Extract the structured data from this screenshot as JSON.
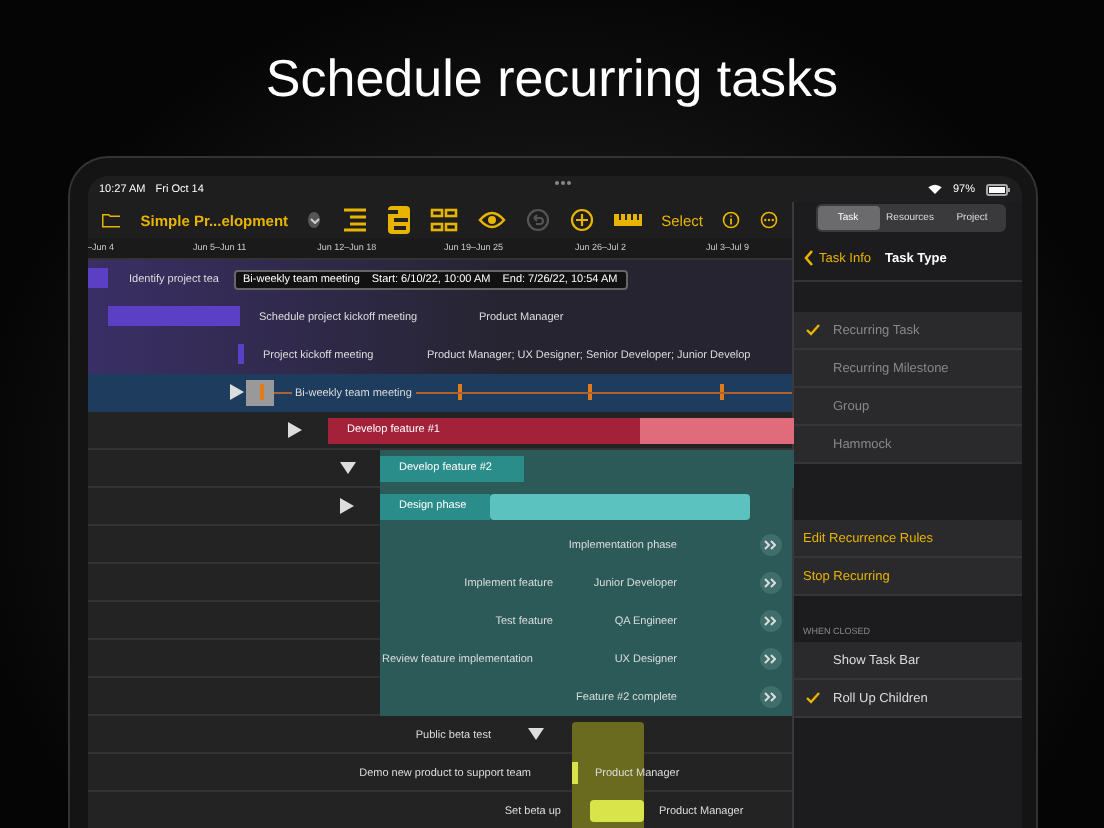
{
  "headline": "Schedule recurring tasks",
  "status_bar": {
    "time": "10:27 AM",
    "date": "Fri Oct 14",
    "battery": "97%"
  },
  "toolbar": {
    "project_title": "Simple Pr...elopment",
    "select": "Select",
    "tools": [
      {
        "kind": "outline",
        "selected": false,
        "disabled": false
      },
      {
        "kind": "gantt",
        "selected": true,
        "disabled": false
      },
      {
        "kind": "network",
        "selected": false,
        "disabled": false
      },
      {
        "kind": "eye",
        "selected": false,
        "disabled": false
      },
      {
        "kind": "undo",
        "selected": false,
        "disabled": true
      },
      {
        "kind": "add",
        "selected": false,
        "disabled": false
      },
      {
        "kind": "ruler",
        "selected": false,
        "disabled": false
      }
    ]
  },
  "timeline": {
    "weeks": [
      "–Jun 4",
      "Jun 5–Jun 11",
      "Jun 12–Jun 18",
      "Jun 19–Jun 25",
      "Jun 26–Jul 2",
      "Jul 3–Jul 9"
    ]
  },
  "tasks": [
    {
      "kind": "task",
      "name": "Identify project tea"
    },
    {
      "kind": "task",
      "name": "Schedule project kickoff meeting",
      "resource": "Product Manager"
    },
    {
      "kind": "task",
      "name": "Project kickoff meeting",
      "resource": "Product Manager; UX Designer; Senior Developer; Junior Develop"
    },
    {
      "kind": "recurring",
      "name": "Bi-weekly team meeting",
      "expanded": false
    },
    {
      "kind": "group",
      "name": "Develop feature #1",
      "expanded": false,
      "level": 0.67
    },
    {
      "kind": "subgroup",
      "name": "Develop feature #2",
      "expanded": true
    },
    {
      "kind": "phase",
      "name": "Design phase",
      "expanded": false
    },
    {
      "kind": "child",
      "name": "Implementation phase"
    },
    {
      "kind": "child",
      "name": "Implement feature",
      "resource": "Junior Developer"
    },
    {
      "kind": "child",
      "name": "Test feature",
      "resource": "QA Engineer"
    },
    {
      "kind": "child",
      "name": "Review feature implementation",
      "resource": "UX Designer"
    },
    {
      "kind": "child",
      "name": "Feature #2 complete"
    },
    {
      "kind": "beta-group",
      "name": "Public beta test",
      "expanded": true
    },
    {
      "kind": "beta-task",
      "name": "Demo new product to support team",
      "resource": "Product Manager"
    },
    {
      "kind": "beta-task",
      "name": "Set beta up",
      "resource": "Product Manager"
    }
  ],
  "tooltip": {
    "name": "Bi-weekly team meeting",
    "start": "Start: 6/10/22, 10:00 AM",
    "end": "End: 7/26/22, 10:54 AM"
  },
  "inspector": {
    "tabs": [
      {
        "label": "Task",
        "selected": true
      },
      {
        "label": "Resources",
        "selected": false
      },
      {
        "label": "Project",
        "selected": false
      }
    ],
    "back": "Task Info",
    "title": "Task Type",
    "types": [
      {
        "label": "Recurring Task",
        "checked": true
      },
      {
        "label": "Recurring Milestone",
        "checked": false
      },
      {
        "label": "Group",
        "checked": false
      },
      {
        "label": "Hammock",
        "checked": false
      }
    ],
    "actions": [
      "Edit Recurrence Rules",
      "Stop Recurring"
    ],
    "section_header": "WHEN CLOSED",
    "when_closed": [
      {
        "label": "Show Task Bar",
        "checked": false
      },
      {
        "label": "Roll Up Children",
        "checked": true
      }
    ]
  }
}
